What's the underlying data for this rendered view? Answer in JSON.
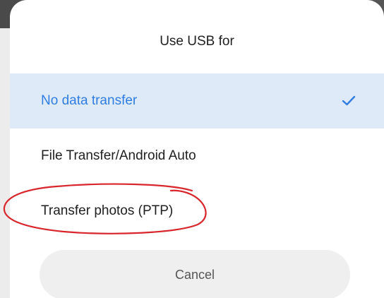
{
  "dialog": {
    "title": "Use USB for",
    "options": [
      {
        "label": "No data transfer",
        "selected": true
      },
      {
        "label": "File Transfer/Android Auto",
        "selected": false
      },
      {
        "label": "Transfer photos (PTP)",
        "selected": false
      }
    ],
    "cancel_label": "Cancel"
  },
  "colors": {
    "accent": "#2f7de1",
    "selected_bg": "#dfeaf8",
    "annotation": "#d9262c"
  },
  "icons": {
    "selected_marker": "check-icon",
    "annotation": "red-circle-annotation"
  }
}
